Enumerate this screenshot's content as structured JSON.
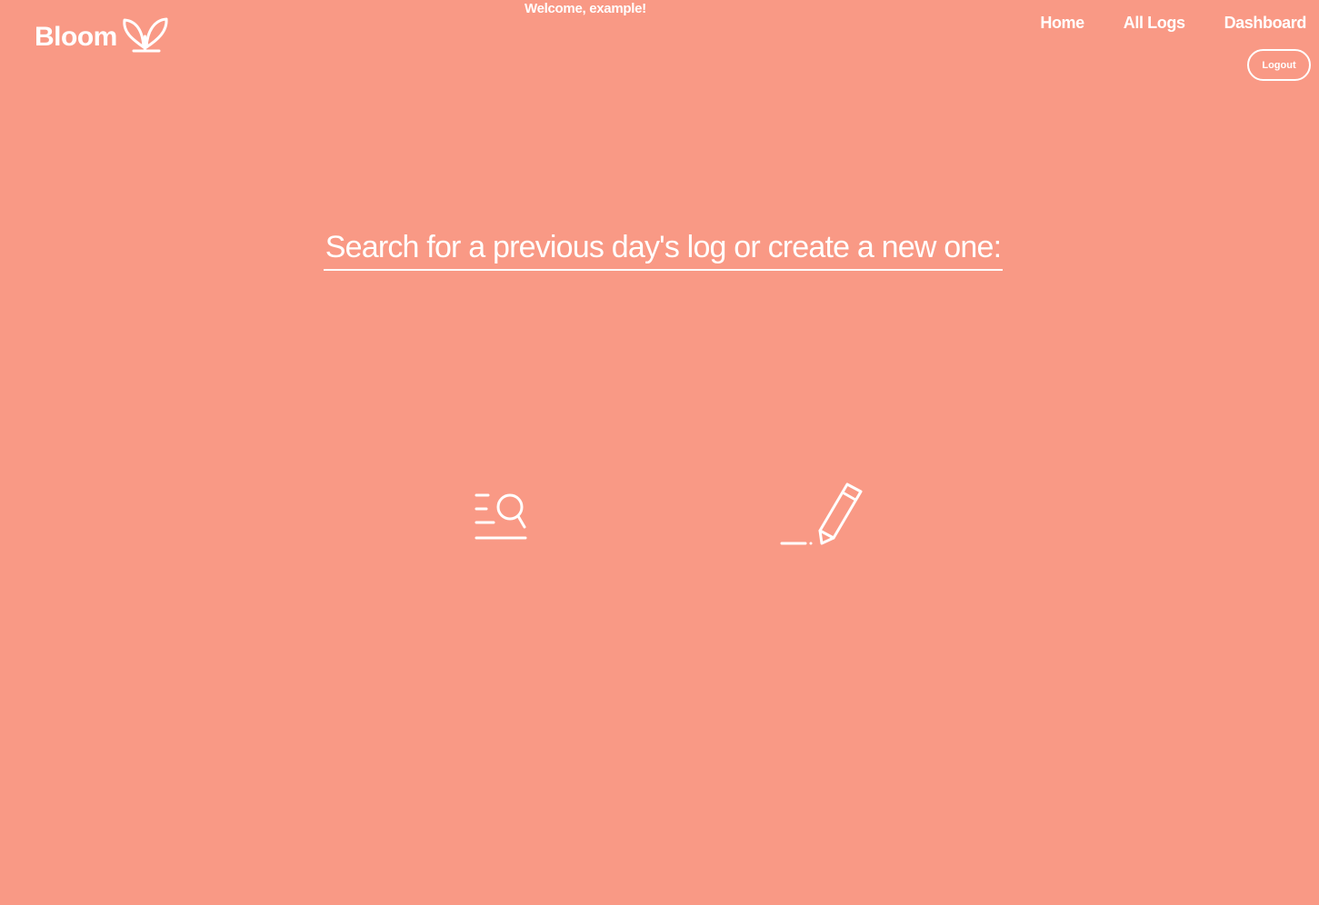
{
  "header": {
    "brand": "Bloom",
    "brand_icon": "sprout-icon",
    "welcome": "Welcome, example!"
  },
  "nav": {
    "items": [
      {
        "label": "Home"
      },
      {
        "label": "All Logs"
      },
      {
        "label": "Dashboard"
      }
    ],
    "logout_label": "Logout"
  },
  "main": {
    "prompt": "Search for a previous day's log or create a new one:",
    "actions": [
      {
        "icon": "search-log-icon"
      },
      {
        "icon": "pencil-icon"
      }
    ]
  },
  "colors": {
    "background": "#F99985",
    "foreground": "#FFFFFF"
  }
}
